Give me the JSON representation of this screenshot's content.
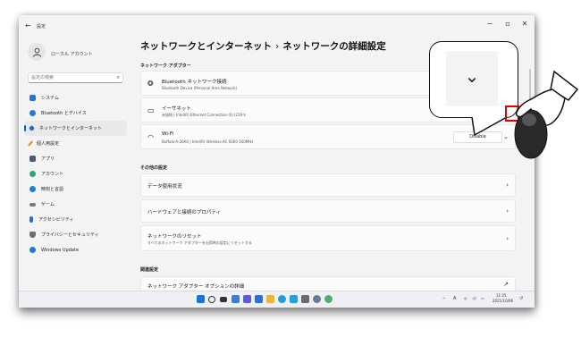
{
  "window": {
    "title": "設定",
    "controls": {
      "minimize": "−",
      "maximize": "▫",
      "close": "✕"
    }
  },
  "account": {
    "name": "ローカル アカウント"
  },
  "search": {
    "placeholder": "設定の検索"
  },
  "sidebar": {
    "items": [
      {
        "label": "システム",
        "color": "#2f6fd1"
      },
      {
        "label": "Bluetooth とデバイス",
        "color": "#1e7fd0"
      },
      {
        "label": "ネットワークとインターネット",
        "color": "#1d6fc9",
        "active": true
      },
      {
        "label": "個人用設定",
        "color": "#d98a2b"
      },
      {
        "label": "アプリ",
        "color": "#4a5a7a"
      },
      {
        "label": "アカウント",
        "color": "#2ea37a"
      },
      {
        "label": "時刻と言語",
        "color": "#1f7fd6"
      },
      {
        "label": "ゲーム",
        "color": "#7a7a7a"
      },
      {
        "label": "アクセシビリティ",
        "color": "#1f6fd1"
      },
      {
        "label": "プライバシーとセキュリティ",
        "color": "#6d6d6d"
      },
      {
        "label": "Windows Update",
        "color": "#1f78d1"
      }
    ]
  },
  "breadcrumb": {
    "parent": "ネットワークとインターネット",
    "separator": "›",
    "current": "ネットワークの詳細設定"
  },
  "sections": {
    "adapters": {
      "title": "ネットワーク アダプター",
      "items": [
        {
          "title": "Bluetooth ネットワーク接続",
          "subtitle": "Bluetooth Device (Personal Area Network)",
          "icon": "bluetooth-network-icon"
        },
        {
          "title": "イーサネット",
          "subtitle": "未接続 | Intel(R) Ethernet Connection (6) I219-V",
          "icon": "ethernet-icon"
        },
        {
          "title": "Wi-Fi",
          "subtitle": "Buffalo-A-26A0 | Intel(R) Wireless-AC 9260 160MHz",
          "icon": "wifi-icon",
          "button": "Disable"
        }
      ]
    },
    "other": {
      "title": "その他の設定",
      "items": [
        {
          "title": "データ使用状況"
        },
        {
          "title": "ハードウェアと接続のプロパティ"
        },
        {
          "title": "ネットワークのリセット",
          "subtitle": "すべてのネットワーク アダプターを出荷時の設定にリセットする"
        }
      ]
    },
    "related": {
      "title": "関連設定",
      "items": [
        {
          "title": "ネットワーク アダプター オプションの詳細"
        }
      ]
    }
  },
  "taskbar": {
    "tray": {
      "lang": "A",
      "time": "11:25",
      "date": "2021/10/06"
    }
  },
  "callout": {
    "icon": "chevron-down-icon"
  }
}
